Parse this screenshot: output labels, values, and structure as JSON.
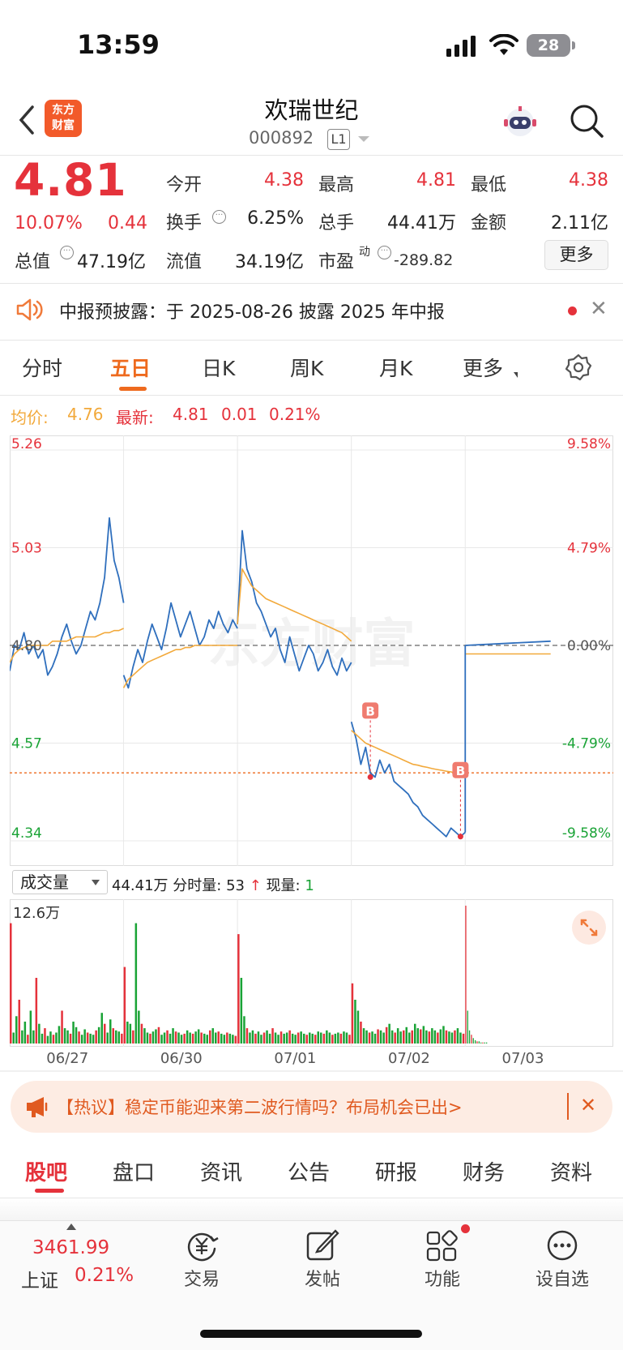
{
  "status_bar": {
    "time": "13:59",
    "battery": "28"
  },
  "header": {
    "title": "欢瑞世纪",
    "code": "000892",
    "level": "L1",
    "logo_line1": "东方",
    "logo_line2": "财富"
  },
  "quote": {
    "price": "4.81",
    "change_pct": "10.07%",
    "change": "0.44",
    "open_label": "今开",
    "open": "4.38",
    "high_label": "最高",
    "high": "4.81",
    "low_label": "最低",
    "low": "4.38",
    "turnover_label": "换手",
    "turnover": "6.25%",
    "volume_label": "总手",
    "volume": "44.41万",
    "amount_label": "金额",
    "amount": "2.11亿",
    "mktcap_label": "总值",
    "mktcap": "47.19亿",
    "float_label": "流值",
    "float_cap": "34.19亿",
    "pe_label": "市盈",
    "pe_sup": "动",
    "pe": "-289.82",
    "more_label": "更多"
  },
  "notice": {
    "text": "中报预披露：于 2025-08-26 披露 2025 年中报"
  },
  "chart_tabs": [
    "分时",
    "五日",
    "日K",
    "周K",
    "月K",
    "更多"
  ],
  "active_chart_tab": "五日",
  "legend": {
    "avg_label": "均价:",
    "avg": "4.76",
    "latest_label": "最新:",
    "latest": "4.81",
    "change": "0.01",
    "pct": "0.21%"
  },
  "volume_panel": {
    "selector": "成交量",
    "total": "44.41万",
    "minute_label": "分时量:",
    "minute": "53",
    "current_label": "现量:",
    "current": "1",
    "max_label": "12.6万"
  },
  "chart_data": {
    "type": "line",
    "price_axis": [
      "5.26",
      "5.03",
      "4.80",
      "4.57",
      "4.34"
    ],
    "pct_axis": [
      "9.58%",
      "4.79%",
      "0.00%",
      "-4.79%",
      "-9.58%"
    ],
    "ylim": [
      4.34,
      5.26
    ],
    "prev_close": 4.8,
    "dates": [
      "06/27",
      "06/30",
      "07/01",
      "07/02",
      "07/03"
    ],
    "series": [
      {
        "name": "价格",
        "color": "#2f6fbd",
        "days": [
          [
            4.74,
            4.8,
            4.79,
            4.83,
            4.78,
            4.8,
            4.77,
            4.79,
            4.73,
            4.75,
            4.78,
            4.82,
            4.85,
            4.81,
            4.78,
            4.8,
            4.84,
            4.88,
            4.86,
            4.9,
            4.96,
            5.1,
            5.0,
            4.96,
            4.9
          ],
          [
            4.73,
            4.7,
            4.75,
            4.79,
            4.76,
            4.81,
            4.85,
            4.82,
            4.79,
            4.84,
            4.9,
            4.86,
            4.82,
            4.85,
            4.88,
            4.84,
            4.8,
            4.82,
            4.86,
            4.84,
            4.88,
            4.85,
            4.83,
            4.86,
            4.84
          ],
          [
            4.85,
            5.07,
            4.98,
            4.95,
            4.9,
            4.88,
            4.85,
            4.82,
            4.84,
            4.79,
            4.76,
            4.82,
            4.78,
            4.74,
            4.77,
            4.8,
            4.78,
            4.74,
            4.76,
            4.79,
            4.75,
            4.73,
            4.77,
            4.74,
            4.76
          ],
          [
            4.62,
            4.58,
            4.52,
            4.56,
            4.5,
            4.49,
            4.53,
            4.5,
            4.52,
            4.48,
            4.47,
            4.46,
            4.45,
            4.43,
            4.42,
            4.4,
            4.39,
            4.38,
            4.37,
            4.36,
            4.35,
            4.37,
            4.36,
            4.35,
            4.36
          ],
          [
            4.8,
            4.81
          ]
        ]
      },
      {
        "name": "均价",
        "color": "#f2a93b",
        "days": [
          [
            4.76,
            4.78,
            4.79,
            4.795,
            4.8,
            4.8,
            4.8,
            4.8,
            4.8,
            4.81,
            4.81,
            4.81,
            4.81,
            4.815,
            4.82,
            4.82,
            4.82,
            4.82,
            4.82,
            4.825,
            4.83,
            4.83,
            4.835,
            4.835,
            4.84
          ],
          [
            4.7,
            4.72,
            4.73,
            4.74,
            4.75,
            4.76,
            4.765,
            4.77,
            4.775,
            4.78,
            4.785,
            4.79,
            4.79,
            4.795,
            4.795,
            4.8,
            4.8,
            4.8,
            4.8,
            4.8,
            4.8,
            4.8,
            4.8,
            4.8,
            4.8
          ],
          [
            4.85,
            4.98,
            4.96,
            4.94,
            4.93,
            4.92,
            4.91,
            4.905,
            4.9,
            4.895,
            4.89,
            4.885,
            4.88,
            4.875,
            4.87,
            4.865,
            4.86,
            4.855,
            4.85,
            4.845,
            4.84,
            4.835,
            4.83,
            4.82,
            4.81
          ],
          [
            4.6,
            4.59,
            4.58,
            4.57,
            4.565,
            4.56,
            4.555,
            4.55,
            4.545,
            4.54,
            4.535,
            4.53,
            4.525,
            4.52,
            4.518,
            4.515,
            4.513,
            4.51,
            4.508,
            4.506,
            4.504,
            4.502,
            4.5,
            4.499,
            4.5
          ],
          [
            4.78,
            4.78
          ]
        ]
      }
    ],
    "volume": [
      [
        110,
        10,
        25,
        40,
        12,
        20,
        8,
        30,
        12,
        60,
        18,
        9,
        14,
        7,
        11,
        8,
        10,
        16,
        30,
        14,
        12,
        9,
        20,
        15,
        11,
        8,
        13,
        10,
        9,
        8,
        12,
        15,
        28,
        18,
        10,
        22,
        14,
        12,
        11,
        9
      ],
      [
        70,
        20,
        18,
        12,
        110,
        30,
        18,
        14,
        10,
        9,
        11,
        13,
        15,
        8,
        10,
        12,
        9,
        14,
        11,
        10,
        8,
        9,
        12,
        10,
        9,
        11,
        13,
        10,
        9,
        8,
        12,
        14,
        10,
        11,
        9,
        8,
        10,
        9,
        8,
        7
      ],
      [
        100,
        60,
        25,
        14,
        10,
        12,
        9,
        11,
        8,
        10,
        12,
        9,
        14,
        10,
        8,
        11,
        9,
        10,
        12,
        9,
        8,
        10,
        11,
        9,
        8,
        10,
        9,
        8,
        11,
        10,
        9,
        12,
        10,
        8,
        9,
        10,
        9,
        11,
        10,
        8
      ],
      [
        55,
        40,
        30,
        20,
        14,
        12,
        10,
        11,
        9,
        13,
        12,
        10,
        15,
        18,
        12,
        10,
        14,
        11,
        12,
        15,
        10,
        12,
        18,
        14,
        13,
        16,
        12,
        11,
        14,
        12,
        10,
        13,
        16,
        12,
        11,
        10,
        12,
        14,
        10,
        9
      ],
      [
        126,
        30,
        12,
        8,
        5,
        3,
        2,
        2,
        1,
        1,
        1,
        1
      ]
    ],
    "buy_marks": [
      {
        "day": 3,
        "index": 4,
        "price": 4.49
      },
      {
        "day": 3,
        "index": 23,
        "price": 4.35
      }
    ],
    "marker_text": "B",
    "watermark": "东方财富"
  },
  "banner": {
    "text": "【热议】稳定币能迎来第二波行情吗？布局机会已出>"
  },
  "bottom_tabs": [
    "股吧",
    "盘口",
    "资讯",
    "公告",
    "研报",
    "财务",
    "资料"
  ],
  "bottom_nav": {
    "index_value": "3461.99",
    "index_name": "上证",
    "index_pct": "0.21%",
    "items": [
      "交易",
      "发帖",
      "功能",
      "设自选"
    ]
  }
}
